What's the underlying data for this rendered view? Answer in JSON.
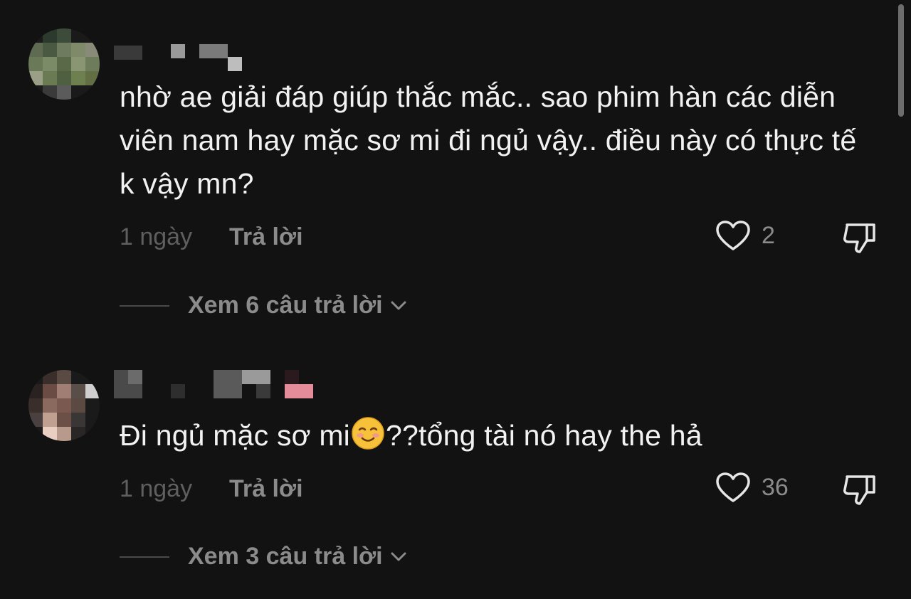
{
  "comments": [
    {
      "text": "nhờ ae giải đáp giúp thắc mắc.. sao phim hàn các diễn viên nam hay mặc sơ mi đi ngủ vậy.. điều này có thực tế k vậy mn?",
      "time": "1 ngày",
      "reply_label": "Trả lời",
      "like_count": "2",
      "view_replies": "Xem 6 câu trả lời"
    },
    {
      "text_before_emoji": "Đi ngủ mặc sơ mi",
      "emoji": "smiling-face-icon",
      "text_after_emoji": "??tổng tài nó hay the hả",
      "time": "1 ngày",
      "reply_label": "Trả lời",
      "like_count": "36",
      "view_replies": "Xem 3 câu trả lời"
    }
  ],
  "colors": {
    "background": "#121212",
    "primary_text": "#f2f2f2",
    "secondary_text": "#8b8b8b",
    "muted_text": "#5f5f5f"
  }
}
